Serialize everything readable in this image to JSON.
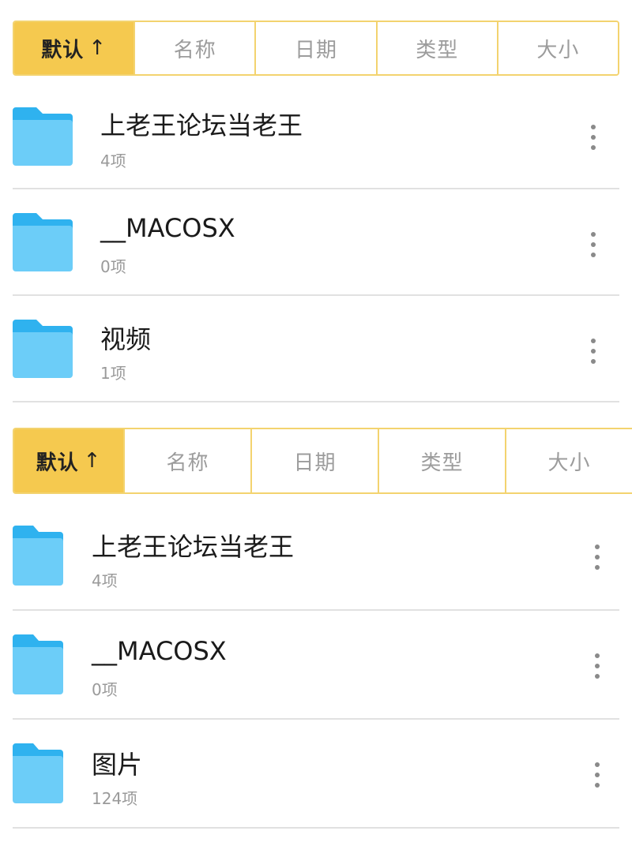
{
  "colors": {
    "accent": "#f5c94f",
    "accent_border": "#f3d36f",
    "folder": "#6ccdf8",
    "folder_back": "#2fb2ef"
  },
  "panels": [
    {
      "sort_tabs": [
        {
          "label": "默认",
          "arrow": "↑",
          "active": true
        },
        {
          "label": "名称"
        },
        {
          "label": "日期"
        },
        {
          "label": "类型"
        },
        {
          "label": "大小"
        }
      ],
      "items": [
        {
          "name": "上老王论坛当老王",
          "count": "4项",
          "icon": "folder-icon",
          "menu_icon": "more-vertical-icon"
        },
        {
          "name": "__MACOSX",
          "count": "0项",
          "icon": "folder-icon",
          "menu_icon": "more-vertical-icon"
        },
        {
          "name": "视频",
          "count": "1项",
          "icon": "folder-icon",
          "menu_icon": "more-vertical-icon"
        }
      ]
    },
    {
      "sort_tabs": [
        {
          "label": "默认",
          "arrow": "↑",
          "active": true
        },
        {
          "label": "名称"
        },
        {
          "label": "日期"
        },
        {
          "label": "类型"
        },
        {
          "label": "大小"
        }
      ],
      "items": [
        {
          "name": "上老王论坛当老王",
          "count": "4项",
          "icon": "folder-icon",
          "menu_icon": "more-vertical-icon"
        },
        {
          "name": "__MACOSX",
          "count": "0项",
          "icon": "folder-icon",
          "menu_icon": "more-vertical-icon"
        },
        {
          "name": "图片",
          "count": "124项",
          "icon": "folder-icon",
          "menu_icon": "more-vertical-icon"
        }
      ]
    }
  ]
}
